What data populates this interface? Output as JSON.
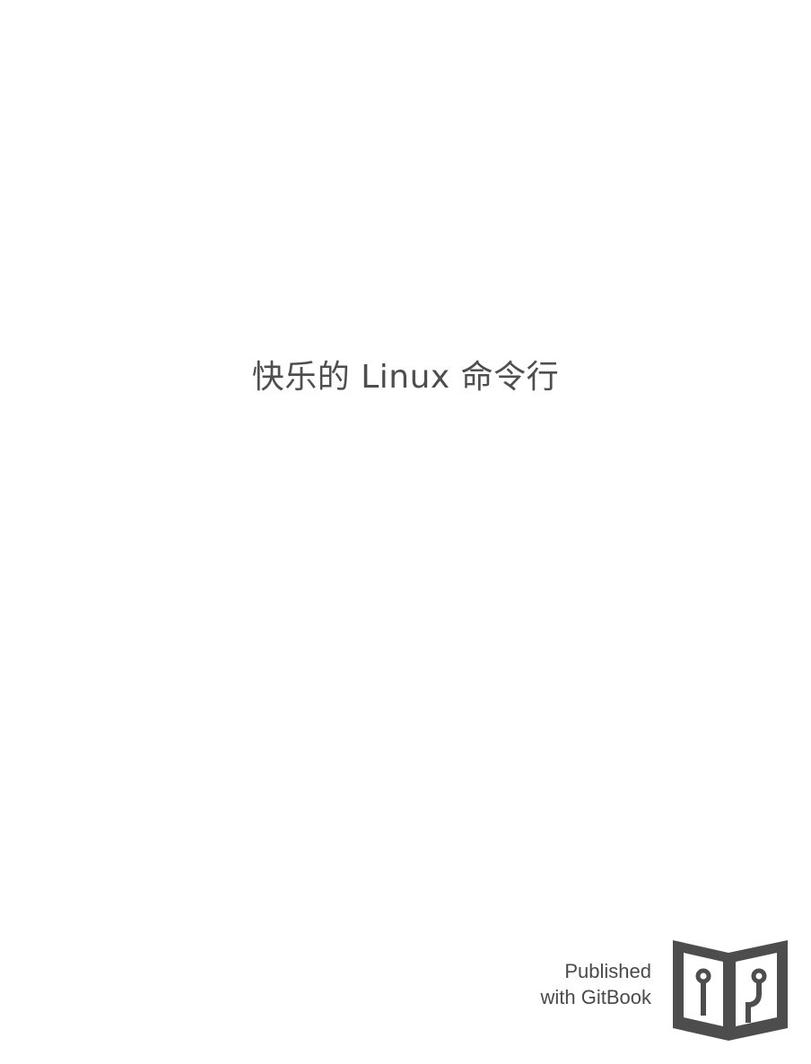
{
  "document": {
    "title": "快乐的 Linux 命令行"
  },
  "publisher": {
    "line1": "Published",
    "line2": "with GitBook",
    "logo_icon": "gitbook-logo-icon"
  },
  "colors": {
    "background": "#ffffff",
    "text": "#4e4e4e",
    "logo": "#4d4d4d"
  }
}
